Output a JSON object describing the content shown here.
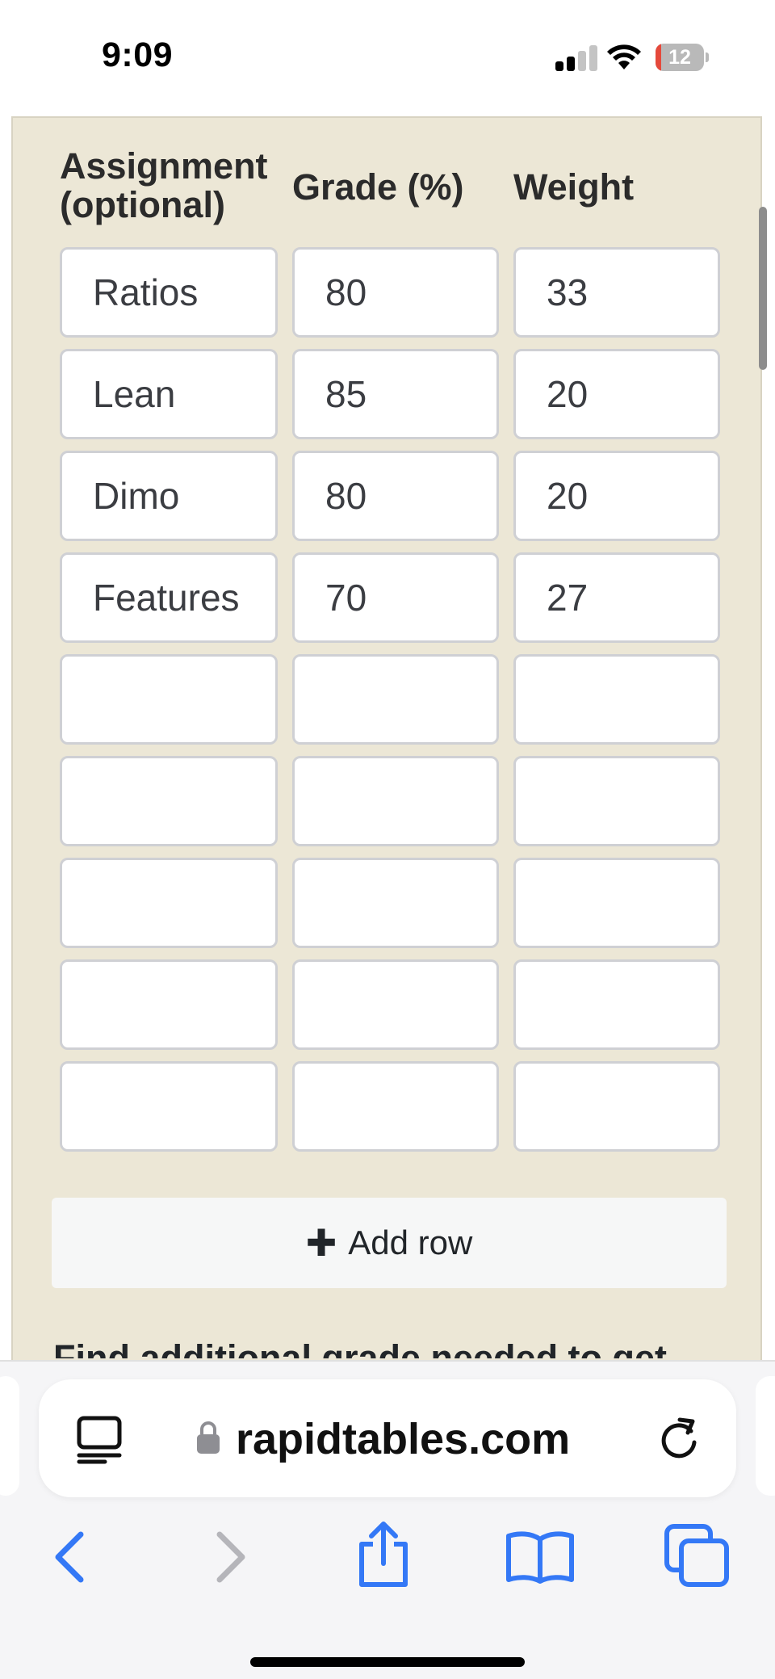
{
  "status_bar": {
    "time": "9:09",
    "battery": "12",
    "battery_level": 0.12,
    "signal_bars": 2
  },
  "table": {
    "headers": {
      "assignment": "Assignment (optional)",
      "grade": "Grade (%)",
      "weight": "Weight"
    },
    "rows": [
      {
        "assignment": "Ratios",
        "grade": "80",
        "weight": "33"
      },
      {
        "assignment": "Lean",
        "grade": "85",
        "weight": "20"
      },
      {
        "assignment": "Dimo",
        "grade": "80",
        "weight": "20"
      },
      {
        "assignment": "Features",
        "grade": "70",
        "weight": "27"
      },
      {
        "assignment": "",
        "grade": "",
        "weight": ""
      },
      {
        "assignment": "",
        "grade": "",
        "weight": ""
      },
      {
        "assignment": "",
        "grade": "",
        "weight": ""
      },
      {
        "assignment": "",
        "grade": "",
        "weight": ""
      },
      {
        "assignment": "",
        "grade": "",
        "weight": ""
      }
    ]
  },
  "add_row_button": {
    "icon": "plus-icon",
    "label": "Add row"
  },
  "find_section": {
    "text": "Find additional grade needed to get"
  },
  "browser": {
    "url": "rapidtables.com",
    "icons": [
      "reader-mode-icon",
      "lock-icon",
      "reload-icon",
      "back-icon",
      "forward-icon",
      "share-icon",
      "bookmarks-icon",
      "tabs-icon"
    ]
  },
  "colors": {
    "panel_bg": "#ece7d6",
    "accent_blue": "#3478f6",
    "battery_low": "#e5493b"
  }
}
